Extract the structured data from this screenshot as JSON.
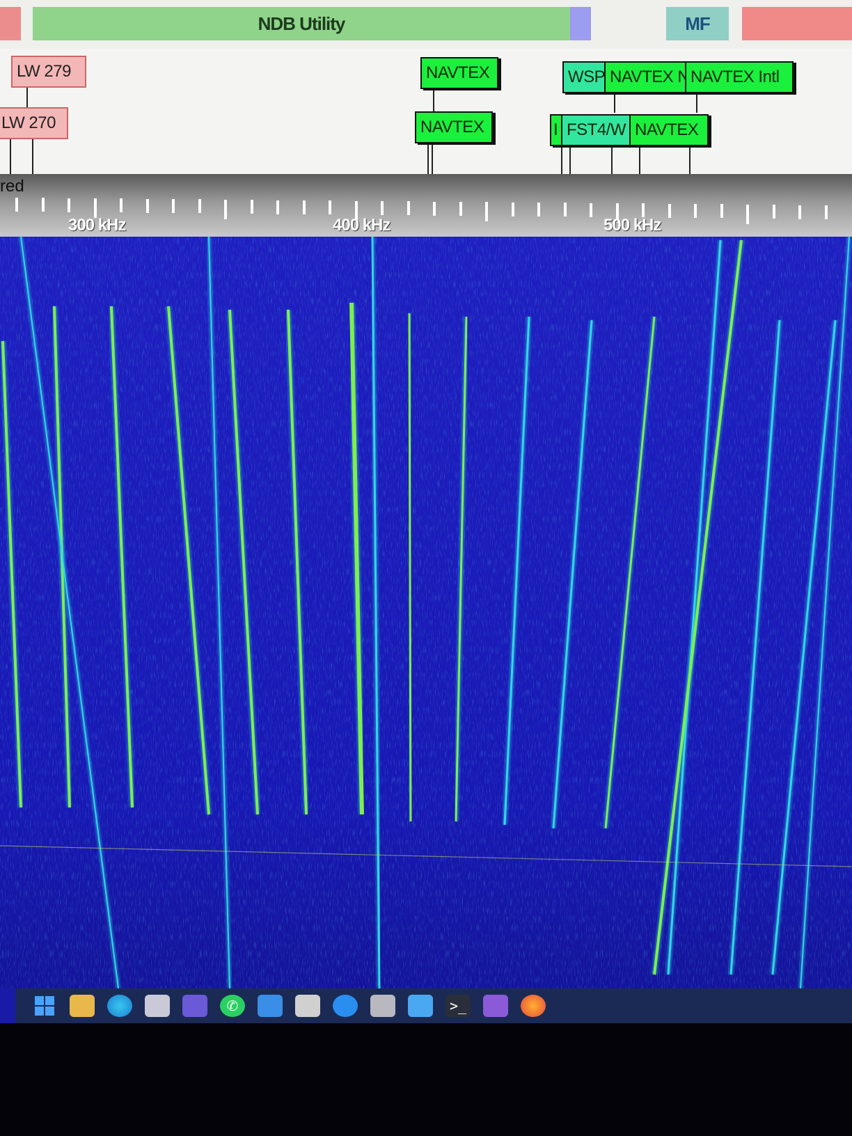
{
  "band_plan": {
    "ndb_label": "NDB Utility",
    "mf_label": "MF"
  },
  "bookmarks": {
    "lw279": "LW 279",
    "lw270": "LW 270",
    "navtex_top": "NAVTEX",
    "navtex_low": "NAVTEX",
    "wsp": "WSP",
    "navtex_n": "NAVTEX N",
    "navtex_intl": "NAVTEX Intl",
    "small_marker": "I",
    "fst4w": "FST4/W",
    "navtex_right": "NAVTEX"
  },
  "scale": {
    "partial_label": "red",
    "freq_labels": [
      "300 kHz",
      "400 kHz",
      "500 kHz"
    ]
  },
  "colors": {
    "waterfall_background": "#1a1ab0",
    "signal_green": "#7df04a",
    "signal_cyan": "#2fd8e6",
    "bookmark_green": "#1bf03c",
    "band_ndb": "#8fd48a",
    "band_mf": "#8fcfc4",
    "band_red": "#ef8a88"
  },
  "taskbar": {
    "icons": [
      "windows-start-icon",
      "file-explorer-icon",
      "edge-browser-icon",
      "store-icon",
      "app-icon",
      "whatsapp-icon",
      "book-icon",
      "app-icon",
      "globe-icon",
      "app-icon",
      "app-icon",
      "terminal-icon",
      "app-icon",
      "firefox-icon"
    ]
  }
}
